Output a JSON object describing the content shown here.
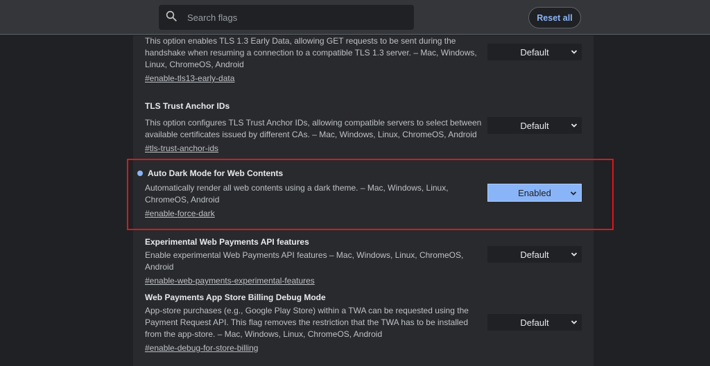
{
  "search": {
    "placeholder": "Search flags",
    "value": ""
  },
  "header": {
    "reset_label": "Reset all"
  },
  "flags": [
    {
      "title": "",
      "desc": "This option enables TLS 1.3 Early Data, allowing GET requests to be sent during the handshake when resuming a connection to a compatible TLS 1.3 server. – Mac, Windows, Linux, ChromeOS, Android",
      "link": "#enable-tls13-early-data",
      "state": "Default"
    },
    {
      "title": "TLS Trust Anchor IDs",
      "desc": "This option configures TLS Trust Anchor IDs, allowing compatible servers to select between available certificates issued by different CAs. – Mac, Windows, Linux, ChromeOS, Android",
      "link": "#tls-trust-anchor-ids",
      "state": "Default"
    },
    {
      "title": "Auto Dark Mode for Web Contents",
      "desc": "Automatically render all web contents using a dark theme. – Mac, Windows, Linux, ChromeOS, Android",
      "link": "#enable-force-dark",
      "state": "Enabled"
    },
    {
      "title": "Experimental Web Payments API features",
      "desc": "Enable experimental Web Payments API features – Mac, Windows, Linux, ChromeOS, Android",
      "link": "#enable-web-payments-experimental-features",
      "state": "Default"
    },
    {
      "title": "Web Payments App Store Billing Debug Mode",
      "desc": "App-store purchases (e.g., Google Play Store) within a TWA can be requested using the Payment Request API. This flag removes the restriction that the TWA has to be installed from the app-store. – Mac, Windows, Linux, ChromeOS, Android",
      "link": "#enable-debug-for-store-billing",
      "state": "Default"
    }
  ],
  "colors": {
    "accent": "#8ab4f8",
    "highlight_border": "#e0151a",
    "background": "#202124",
    "panel": "#292a2d"
  },
  "icons": {
    "search": "search-icon",
    "select": "chevron-down-icon"
  }
}
